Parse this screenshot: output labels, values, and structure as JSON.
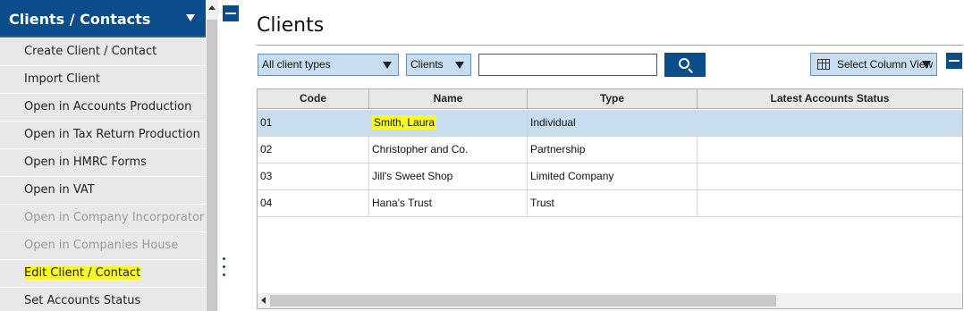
{
  "sidebar": {
    "title": "Clients / Contacts",
    "items": [
      {
        "label": "Create Client / Contact",
        "enabled": true,
        "highlighted": false
      },
      {
        "label": "Import Client",
        "enabled": true,
        "highlighted": false
      },
      {
        "label": "Open in Accounts Production",
        "enabled": true,
        "highlighted": false
      },
      {
        "label": "Open in Tax Return Production",
        "enabled": true,
        "highlighted": false
      },
      {
        "label": "Open in HMRC Forms",
        "enabled": true,
        "highlighted": false
      },
      {
        "label": "Open in VAT",
        "enabled": true,
        "highlighted": false
      },
      {
        "label": "Open in Company Incorporator",
        "enabled": false,
        "highlighted": false
      },
      {
        "label": "Open in Companies House Forms",
        "enabled": false,
        "highlighted": false
      },
      {
        "label": "Edit Client / Contact",
        "enabled": true,
        "highlighted": true
      },
      {
        "label": "Set Accounts Status",
        "enabled": true,
        "highlighted": false
      }
    ]
  },
  "main": {
    "title": "Clients",
    "filters": {
      "client_type": "All client types",
      "category": "Clients",
      "search_value": ""
    },
    "column_view_label": "Select Column View",
    "table": {
      "columns": [
        "Code",
        "Name",
        "Type",
        "Latest Accounts Status"
      ],
      "rows": [
        {
          "code": "01",
          "name": "Smith, Laura",
          "type": "Individual",
          "status": ""
        },
        {
          "code": "02",
          "name": "Christopher and Co.",
          "type": "Partnership",
          "status": ""
        },
        {
          "code": "03",
          "name": "Jill's Sweet Shop",
          "type": "Limited Company",
          "status": ""
        },
        {
          "code": "04",
          "name": "Hana's Trust",
          "type": "Trust",
          "status": ""
        }
      ],
      "selected_row": 0,
      "highlighted_name_row": 0
    }
  },
  "colors": {
    "brand": "#0b4d8a",
    "selection": "#c8ddf0",
    "highlight": "#fafa22",
    "sidebar_bg": "#e8e8e8"
  }
}
